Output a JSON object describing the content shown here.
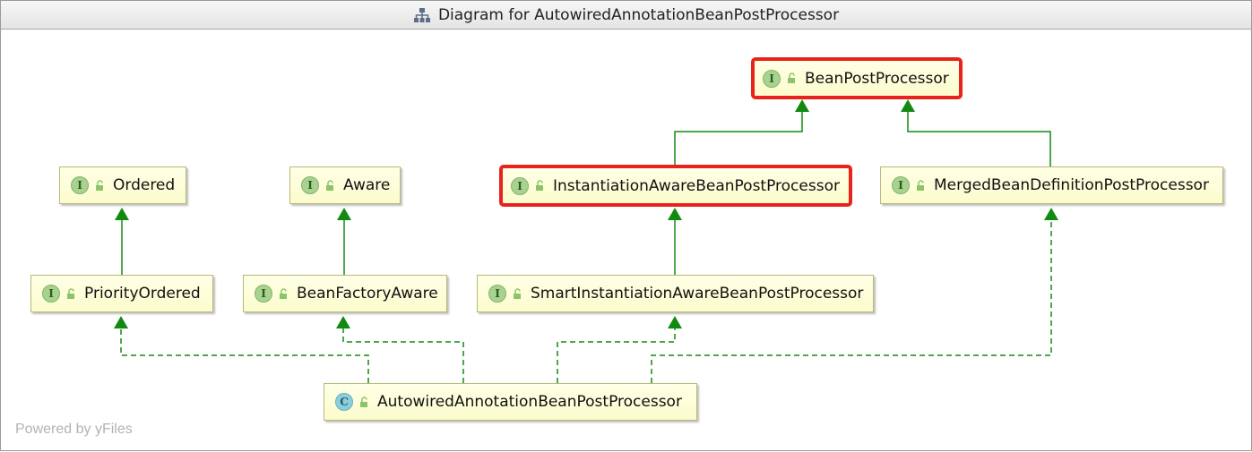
{
  "window": {
    "title": "Diagram for AutowiredAnnotationBeanPostProcessor",
    "title_icon": "hierarchy-icon"
  },
  "diagram": {
    "kind_labels": {
      "interface": "I",
      "class": "C"
    },
    "highlight_color": "#e8231d",
    "edge_color": "#128a12",
    "nodes": {
      "bean_post_processor": {
        "label": "BeanPostProcessor",
        "kind": "interface",
        "highlighted": true
      },
      "ordered": {
        "label": "Ordered",
        "kind": "interface",
        "highlighted": false
      },
      "aware": {
        "label": "Aware",
        "kind": "interface",
        "highlighted": false
      },
      "instantiation_aware": {
        "label": "InstantiationAwareBeanPostProcessor",
        "kind": "interface",
        "highlighted": true
      },
      "merged_bean_definition": {
        "label": "MergedBeanDefinitionPostProcessor",
        "kind": "interface",
        "highlighted": false
      },
      "priority_ordered": {
        "label": "PriorityOrdered",
        "kind": "interface",
        "highlighted": false
      },
      "bean_factory_aware": {
        "label": "BeanFactoryAware",
        "kind": "interface",
        "highlighted": false
      },
      "smart_instantiation_aware": {
        "label": "SmartInstantiationAwareBeanPostProcessor",
        "kind": "interface",
        "highlighted": false
      },
      "autowired": {
        "label": "AutowiredAnnotationBeanPostProcessor",
        "kind": "class",
        "highlighted": false
      }
    },
    "edges": [
      {
        "from": "instantiation_aware",
        "to": "bean_post_processor",
        "type": "extends"
      },
      {
        "from": "merged_bean_definition",
        "to": "bean_post_processor",
        "type": "extends"
      },
      {
        "from": "priority_ordered",
        "to": "ordered",
        "type": "extends"
      },
      {
        "from": "bean_factory_aware",
        "to": "aware",
        "type": "extends"
      },
      {
        "from": "smart_instantiation_aware",
        "to": "instantiation_aware",
        "type": "extends"
      },
      {
        "from": "autowired",
        "to": "priority_ordered",
        "type": "implements"
      },
      {
        "from": "autowired",
        "to": "bean_factory_aware",
        "type": "implements"
      },
      {
        "from": "autowired",
        "to": "smart_instantiation_aware",
        "type": "implements"
      },
      {
        "from": "autowired",
        "to": "merged_bean_definition",
        "type": "implements"
      }
    ]
  },
  "footer": {
    "text": "Powered by yFiles"
  }
}
